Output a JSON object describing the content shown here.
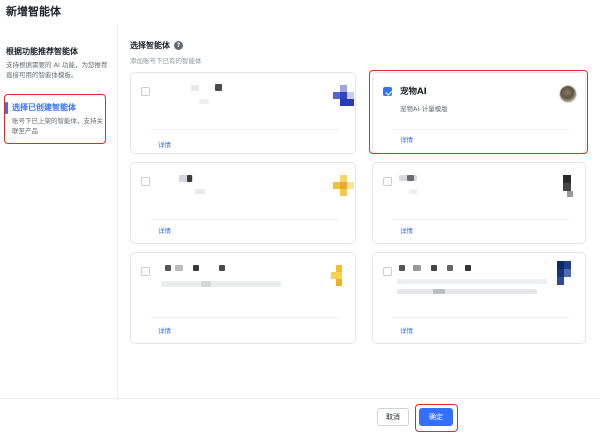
{
  "dialog": {
    "title": "新增智能体"
  },
  "sidebar": {
    "items": [
      {
        "title": "根据功能推荐智能体",
        "desc": "支持根据需要的 AI 功能，为您推荐直接可用的智能体模板。"
      },
      {
        "title": "选择已创建智能体",
        "desc": "账号下已上架的智能体，支持关联至产品"
      }
    ],
    "active_index": 1
  },
  "main": {
    "section_title": "选择智能体",
    "help_icon": "question-circle-icon",
    "section_subtitle": "添加账号下已有的智能体"
  },
  "cards": [
    {
      "checked": false,
      "detail_label": "详情"
    },
    {
      "checked": true,
      "name": "宠物AI",
      "desc": "宠物AI-计量模版",
      "detail_label": "详情"
    },
    {
      "checked": false,
      "detail_label": "详情"
    },
    {
      "checked": false,
      "detail_label": "详情"
    },
    {
      "checked": false,
      "detail_label": "详情"
    },
    {
      "checked": false,
      "detail_label": "详情"
    }
  ],
  "footer": {
    "cancel_label": "取消",
    "ok_label": "确定"
  },
  "colors": {
    "accent": "#3370ff",
    "highlight": "#e02a2a"
  }
}
